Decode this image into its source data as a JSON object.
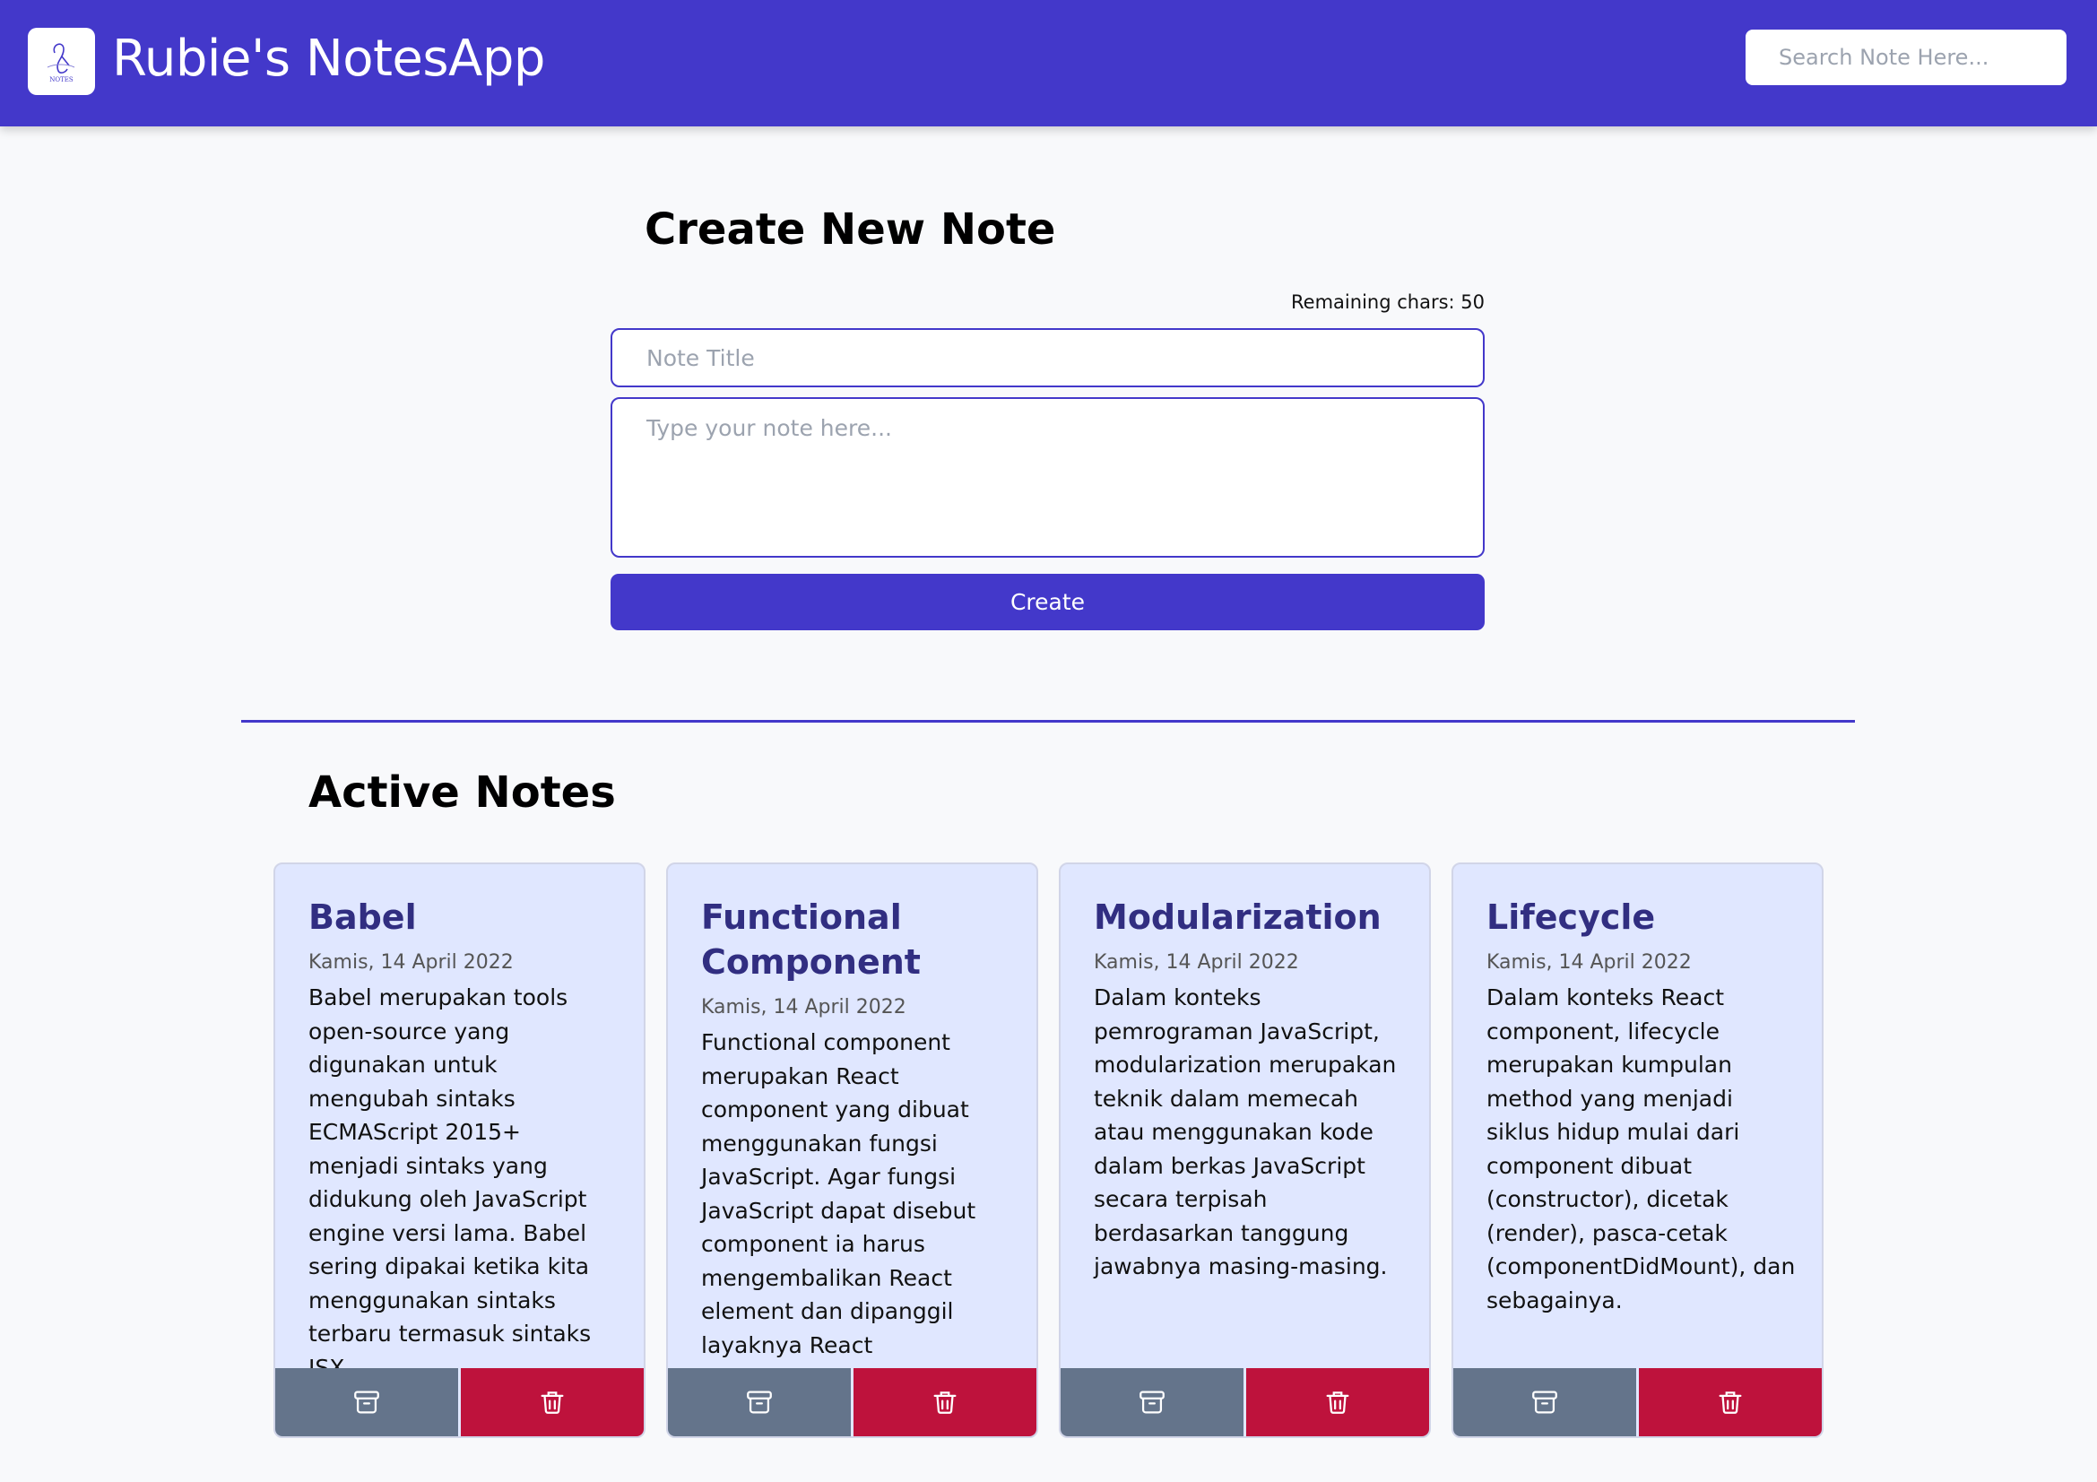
{
  "header": {
    "app_title": "Rubie's NotesApp",
    "logo_text": "NOTES",
    "search_placeholder": "Search Note Here...",
    "background_color": "#4338ca"
  },
  "create_form": {
    "heading": "Create New Note",
    "remaining_chars": "Remaining chars: 50",
    "title_placeholder": "Note Title",
    "body_placeholder": "Type your note here...",
    "create_label": "Create"
  },
  "active_notes": {
    "heading": "Active Notes",
    "notes": [
      {
        "title": "Babel",
        "date": "Kamis, 14 April 2022",
        "body": "Babel merupakan tools open-source yang digunakan untuk mengubah sintaks ECMAScript 2015+ menjadi sintaks yang didukung oleh JavaScript engine versi lama. Babel sering dipakai ketika kita menggunakan sintaks terbaru termasuk sintaks JSX."
      },
      {
        "title": "Functional Component",
        "date": "Kamis, 14 April 2022",
        "body": "Functional component merupakan React component yang dibuat menggunakan fungsi JavaScript. Agar fungsi JavaScript dapat disebut component ia harus mengembalikan React element dan dipanggil layaknya React component."
      },
      {
        "title": "Modularization",
        "date": "Kamis, 14 April 2022",
        "body": "Dalam konteks pemrograman JavaScript, modularization merupakan teknik dalam memecah atau menggunakan kode dalam berkas JavaScript secara terpisah berdasarkan tanggung jawabnya masing-masing."
      },
      {
        "title": "Lifecycle",
        "date": "Kamis, 14 April 2022",
        "body": "Dalam konteks React component, lifecycle merupakan kumpulan method yang menjadi siklus hidup mulai dari component dibuat (constructor), dicetak (render), pasca-cetak (componentDidMount), dan sebagainya."
      }
    ],
    "archive_icon": "archive-icon",
    "delete_icon": "trash-icon",
    "archive_color": "#64748b",
    "delete_color": "#be123c"
  }
}
